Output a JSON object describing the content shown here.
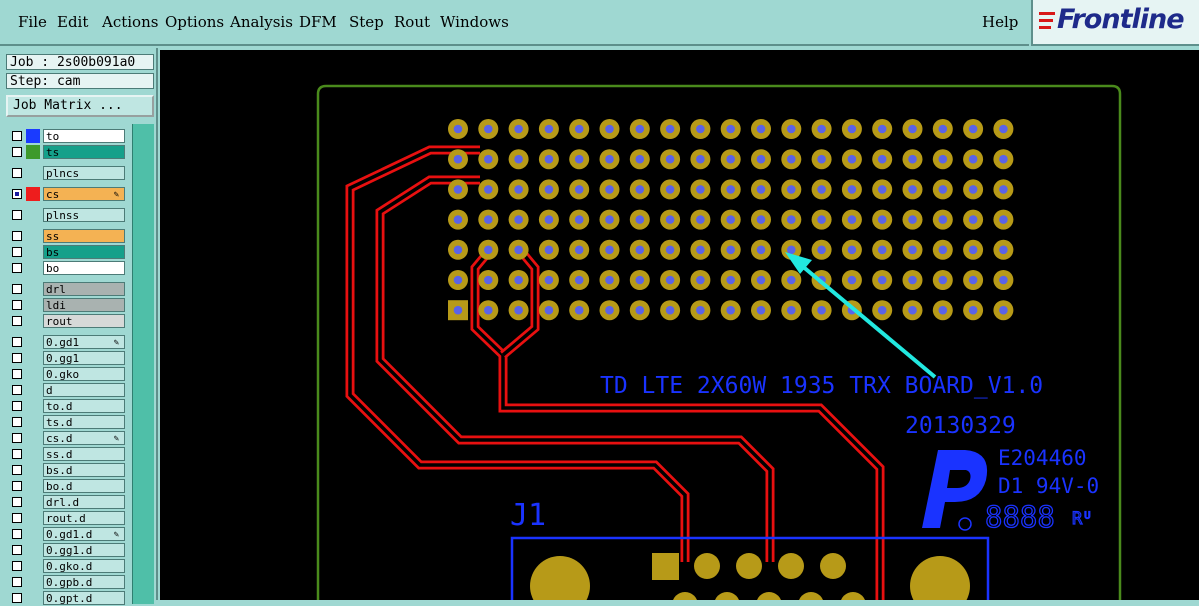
{
  "menu": {
    "file": "File",
    "edit": "Edit",
    "actions": "Actions",
    "options": "Options",
    "analysis": "Analysis",
    "dfm": "DFM",
    "step": "Step",
    "rout": "Rout",
    "windows": "Windows",
    "help": "Help"
  },
  "logo": {
    "text": "Frontline"
  },
  "job": {
    "job_line": "Job : 2s00b091a0",
    "step_line": "Step: cam",
    "matrix_button": "Job Matrix ..."
  },
  "layers": [
    {
      "name": "to",
      "color": "#ffffff",
      "swatch": "#1a3bff",
      "checked": false,
      "group_start": true
    },
    {
      "name": "ts",
      "color": "#15a08a",
      "swatch": "#3d9a2c",
      "checked": false
    },
    {
      "name": "plncs",
      "color": "#bfe6e2",
      "swatch": "",
      "checked": false,
      "group_start": true
    },
    {
      "name": "cs",
      "color": "#f4b253",
      "swatch": "#ee1d1d",
      "checked": true,
      "pen": true,
      "group_start": true
    },
    {
      "name": "plnss",
      "color": "#bfe6e2",
      "swatch": "",
      "checked": false,
      "group_start": true
    },
    {
      "name": "ss",
      "color": "#f4b253",
      "swatch": "",
      "checked": false,
      "group_start": true
    },
    {
      "name": "bs",
      "color": "#15a08a",
      "swatch": "",
      "checked": false
    },
    {
      "name": "bo",
      "color": "#ffffff",
      "swatch": "",
      "checked": false
    },
    {
      "name": "drl",
      "color": "#a9b2b0",
      "swatch": "",
      "checked": false,
      "group_start": true
    },
    {
      "name": "ldi",
      "color": "#a9b2b0",
      "swatch": "",
      "checked": false
    },
    {
      "name": "rout",
      "color": "#d6d9d8",
      "swatch": "",
      "checked": false
    },
    {
      "name": "0.gd1",
      "color": "#bfe6e2",
      "swatch": "",
      "checked": false,
      "pen": true,
      "group_start": true
    },
    {
      "name": "0.gg1",
      "color": "#bfe6e2",
      "swatch": "",
      "checked": false
    },
    {
      "name": "0.gko",
      "color": "#bfe6e2",
      "swatch": "",
      "checked": false
    },
    {
      "name": "d",
      "color": "#bfe6e2",
      "swatch": "",
      "checked": false
    },
    {
      "name": "to.d",
      "color": "#bfe6e2",
      "swatch": "",
      "checked": false
    },
    {
      "name": "ts.d",
      "color": "#bfe6e2",
      "swatch": "",
      "checked": false
    },
    {
      "name": "cs.d",
      "color": "#bfe6e2",
      "swatch": "",
      "checked": false,
      "pen": true
    },
    {
      "name": "ss.d",
      "color": "#bfe6e2",
      "swatch": "",
      "checked": false
    },
    {
      "name": "bs.d",
      "color": "#bfe6e2",
      "swatch": "",
      "checked": false
    },
    {
      "name": "bo.d",
      "color": "#bfe6e2",
      "swatch": "",
      "checked": false
    },
    {
      "name": "drl.d",
      "color": "#bfe6e2",
      "swatch": "",
      "checked": false
    },
    {
      "name": "rout.d",
      "color": "#bfe6e2",
      "swatch": "",
      "checked": false
    },
    {
      "name": "0.gd1.d",
      "color": "#bfe6e2",
      "swatch": "",
      "checked": false,
      "pen": true
    },
    {
      "name": "0.gg1.d",
      "color": "#bfe6e2",
      "swatch": "",
      "checked": false
    },
    {
      "name": "0.gko.d",
      "color": "#bfe6e2",
      "swatch": "",
      "checked": false
    },
    {
      "name": "0.gpb.d",
      "color": "#bfe6e2",
      "swatch": "",
      "checked": false
    },
    {
      "name": "0.gpt.d",
      "color": "#bfe6e2",
      "swatch": "",
      "checked": false
    }
  ],
  "board": {
    "silk_line1": "TD LTE 2X60W 1935  TRX BOARD_V1.0",
    "silk_date": "20130329",
    "ul_code": "E204460",
    "ul_grade": "D1  94V-0",
    "date_code": "8888",
    "connector_ref": "J1",
    "pad_color": "#b79a18",
    "hole_color": "#5a63e8",
    "trace_color": "#e81010",
    "silk_color": "#1a33ff",
    "outline_color": "#4a8a1c",
    "arrow_color": "#22e8e0"
  }
}
